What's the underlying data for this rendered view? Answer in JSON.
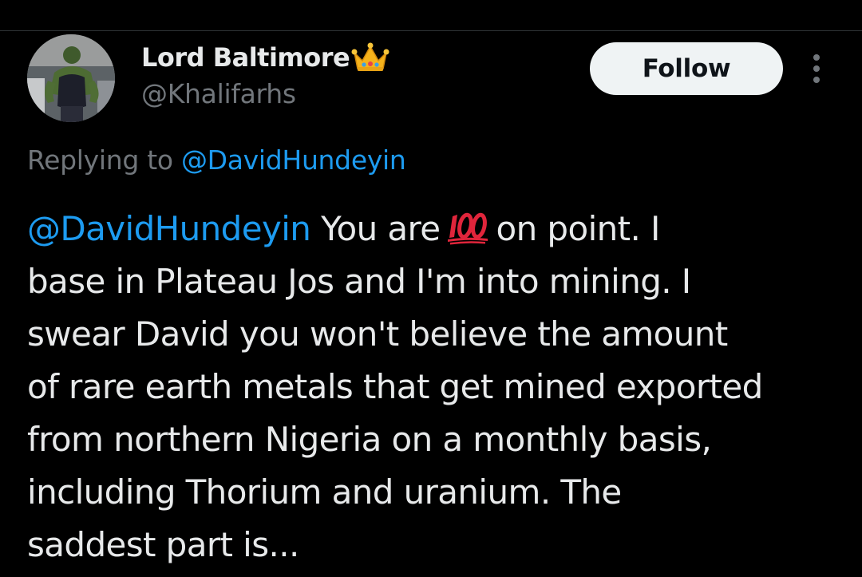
{
  "author": {
    "display_name": "Lord Baltimore",
    "display_name_emoji": "crown-icon",
    "handle": "@Khalifarhs",
    "avatar": "avatar"
  },
  "actions": {
    "follow_label": "Follow",
    "more_icon": "more-options-icon"
  },
  "reply": {
    "prefix": "Replying to",
    "mention": "@DavidHundeyin"
  },
  "tweet": {
    "lines": [
      {
        "mention": "@DavidHundeyin",
        "before_emoji": " You are",
        "after_emoji": "on point. I"
      },
      {
        "text": "base in Plateau Jos and I'm into mining. I"
      },
      {
        "text": "swear David you won't believe the amount"
      },
      {
        "text": "of rare earth metals that get mined exported"
      },
      {
        "text": "from northern Nigeria on a monthly basis,"
      },
      {
        "text": "including Thorium and uranium. The"
      },
      {
        "text": "saddest part is..."
      }
    ],
    "emoji": "hundred-points-icon"
  },
  "colors": {
    "background": "#000000",
    "text": "#e7e9ea",
    "secondary": "#71767b",
    "link": "#1d9bf0",
    "follow_bg": "#eff3f4"
  }
}
